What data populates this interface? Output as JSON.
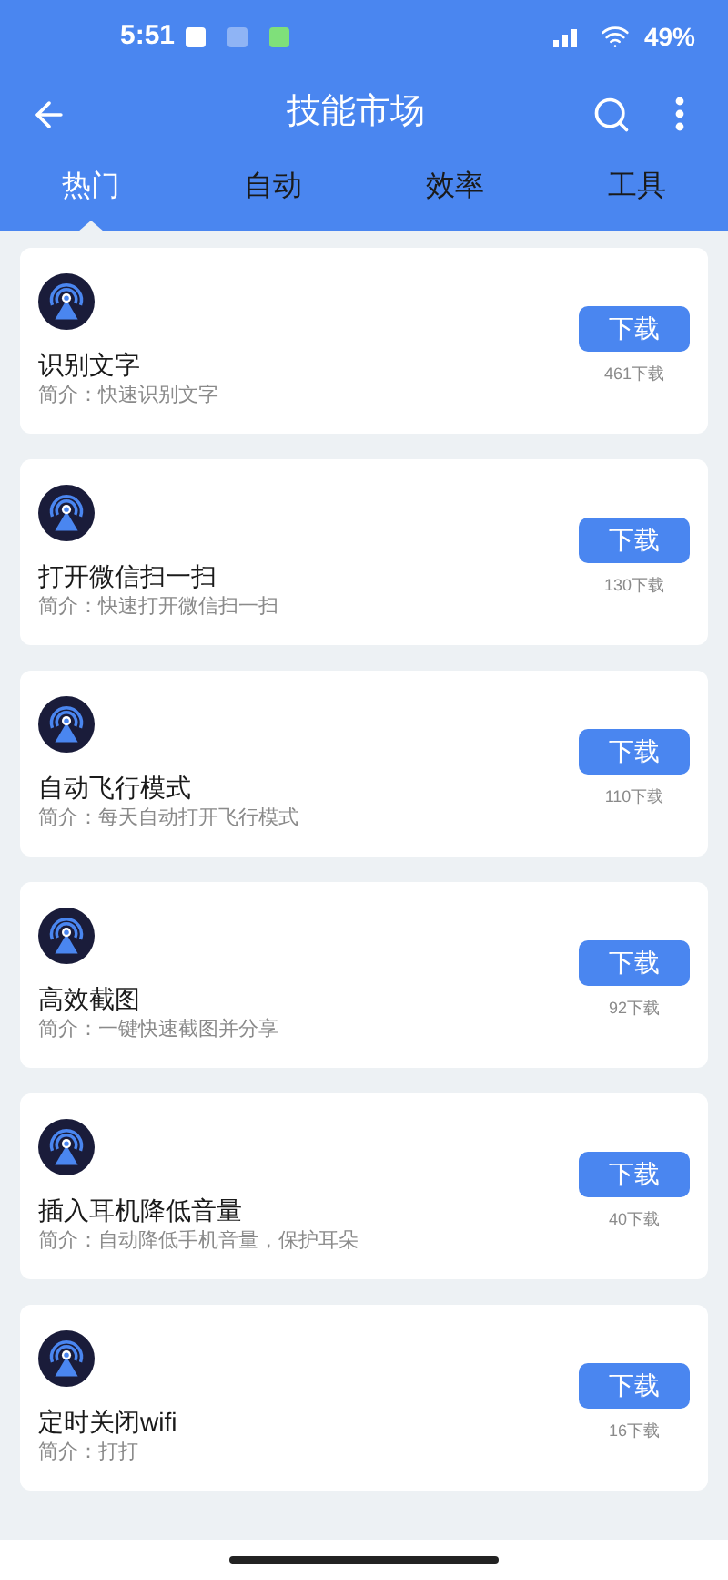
{
  "status_bar": {
    "time": "5:51",
    "battery": "49%"
  },
  "header": {
    "title": "技能市场"
  },
  "tabs": [
    {
      "label": "热门",
      "selected": true
    },
    {
      "label": "自动",
      "selected": false
    },
    {
      "label": "效率",
      "selected": false
    },
    {
      "label": "工具",
      "selected": false
    }
  ],
  "skills": [
    {
      "name": "识别文字",
      "description": "简介：快速识别文字",
      "button": "下载",
      "downloads": "461下载"
    },
    {
      "name": "打开微信扫一扫",
      "description": "简介：快速打开微信扫一扫",
      "button": "下载",
      "downloads": "130下载"
    },
    {
      "name": "自动飞行模式",
      "description": "简介：每天自动打开飞行模式",
      "button": "下载",
      "downloads": "110下载"
    },
    {
      "name": "高效截图",
      "description": "简介：一键快速截图并分享",
      "button": "下载",
      "downloads": "92下载"
    },
    {
      "name": "插入耳机降低音量",
      "description": "简介：自动降低手机音量，保护耳朵",
      "button": "下载",
      "downloads": "40下载"
    },
    {
      "name": "定时关闭wifi",
      "description": "简介：打打",
      "button": "下载",
      "downloads": "16下载"
    }
  ]
}
